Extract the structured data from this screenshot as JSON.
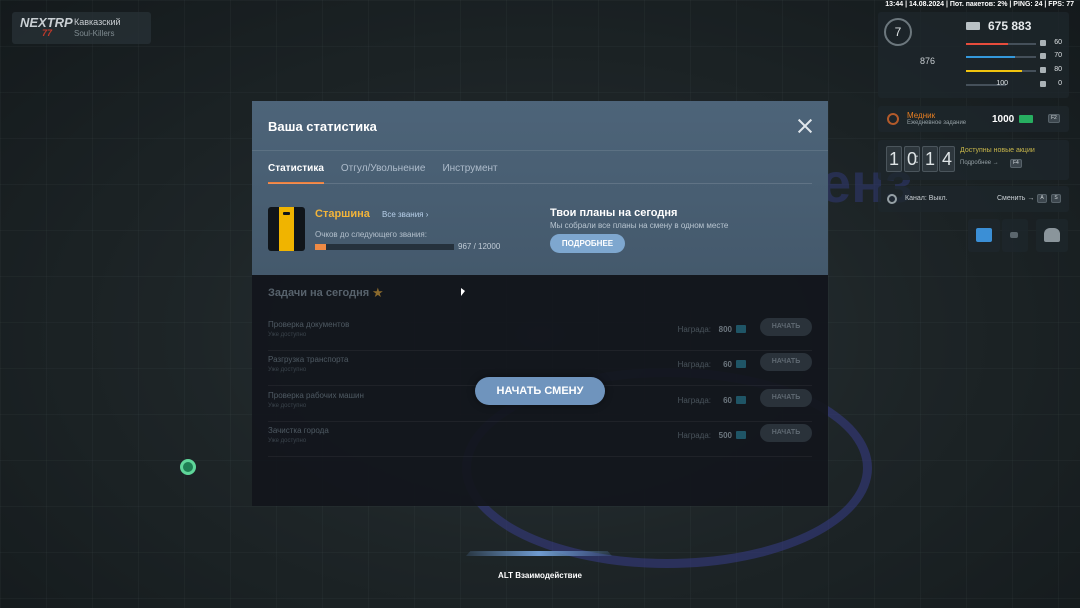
{
  "status_bar": "13:44 | 14.08.2024 | Пот. пакетов: 2% | PING: 24 | FPS: 77",
  "server": {
    "logo": "NEXTRP",
    "logo_sub": "77",
    "name": "Кавказский",
    "sub": "Soul-Killers"
  },
  "hud": {
    "level": "7",
    "money": "675 883",
    "small_value": "876",
    "stats": [
      {
        "value": "60",
        "color": "#e74c3c",
        "fill": 0.6
      },
      {
        "value": "70",
        "color": "#3498db",
        "fill": 0.7
      },
      {
        "value": "80",
        "color": "#f1c40f",
        "fill": 0.8
      },
      {
        "value": "0",
        "color": "#95a5a6",
        "fill": 0.0
      }
    ],
    "ammo": "100",
    "daily_task": {
      "title": "Медник",
      "subtitle": "Ежедневное задание",
      "reward": "1000",
      "key": "F2"
    },
    "clock": {
      "h1": "1",
      "h2": "0",
      "m1": "1",
      "m2": "4"
    },
    "promo": {
      "title": "Доступны новые акции",
      "sub": "Подробнее →",
      "key": "F4"
    },
    "voice": {
      "label": "Канал: Выкл.",
      "change": "Сменить →",
      "key1": "A",
      "key2": "S"
    }
  },
  "modal": {
    "title": "Ваша статистика",
    "tabs": [
      "Статистика",
      "Отгул/Увольнение",
      "Инструмент"
    ],
    "rank": {
      "name": "Старшина",
      "all_ranks_link": "Все звания ›",
      "points_label": "Очков до следующего звания:",
      "progress_text": "967 / 12000",
      "progress_fraction": 0.0806
    },
    "plans": {
      "title": "Твои планы на сегодня",
      "subtitle": "Мы собрали все планы на смену в одном месте",
      "button": "ПОДРОБНЕЕ"
    },
    "tasks_title": "Задачи на сегодня",
    "reward_label": "Награда:",
    "start_label": "НАЧАТЬ",
    "tasks": [
      {
        "name": "Проверка документов",
        "status": "Уже доступно",
        "reward": "800"
      },
      {
        "name": "Разгрузка транспорта",
        "status": "Уже доступно",
        "reward": "60"
      },
      {
        "name": "Проверка рабочих машин",
        "status": "Уже доступно",
        "reward": "60"
      },
      {
        "name": "Зачистка города",
        "status": "Уже доступно",
        "reward": "500"
      }
    ],
    "start_shift": "НАЧАТЬ СМЕНУ"
  },
  "interaction_prompt": "ALT Взаимодействие",
  "wall_text": "енз"
}
